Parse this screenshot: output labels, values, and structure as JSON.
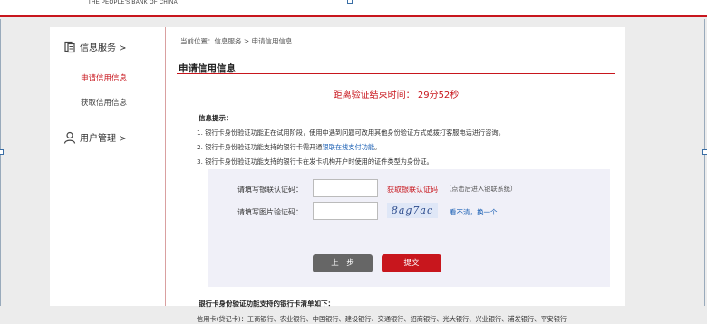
{
  "header": {
    "brand_en": "THE PEOPLE'S BANK OF CHINA"
  },
  "sidebar": {
    "info_service": "信息服务 >",
    "items": [
      {
        "label": "申请信用信息",
        "active": true
      },
      {
        "label": "获取信用信息",
        "active": false
      }
    ],
    "user_manage": "用户管理 >"
  },
  "breadcrumb": "当前位置：信息服务 > 申请信用信息",
  "section_title": "申请信用信息",
  "countdown": "距离验证结束时间： 29分52秒",
  "tips": {
    "heading": "信息提示：",
    "line1": "1. 银行卡身份验证功能正在试用阶段，使用中遇到问题可改用其他身份验证方式或拨打客服电话进行咨询。",
    "line2_pre": "2. 银行卡身份验证功能支持的银行卡需开通",
    "line2_link": "银联在线支付功能",
    "line2_post": "。",
    "line3": "3. 银行卡身份验证功能支持的银行卡在发卡机构开户时使用的证件类型为身份证。"
  },
  "form": {
    "unionpay_label": "请填写银联认证码：",
    "unionpay_value": "",
    "get_code_link": "获取银联认证码",
    "get_code_note": "（点击后进入银联系统）",
    "image_label": "请填写图片验证码：",
    "image_value": "",
    "captcha_text": "8ag7ac",
    "refresh_link": "看不清，换一个",
    "back_button": "上一步",
    "submit_button": "提交"
  },
  "banks": {
    "heading": "银行卡身份验证功能支持的银行卡清单如下：",
    "list": "信用卡(贷记卡)：工商银行、农业银行、中国银行、建设银行、交通银行、招商银行、光大银行、兴业银行、浦发银行、平安银行"
  },
  "colors": {
    "accent": "#c8161d",
    "link": "#1a5fb4"
  }
}
